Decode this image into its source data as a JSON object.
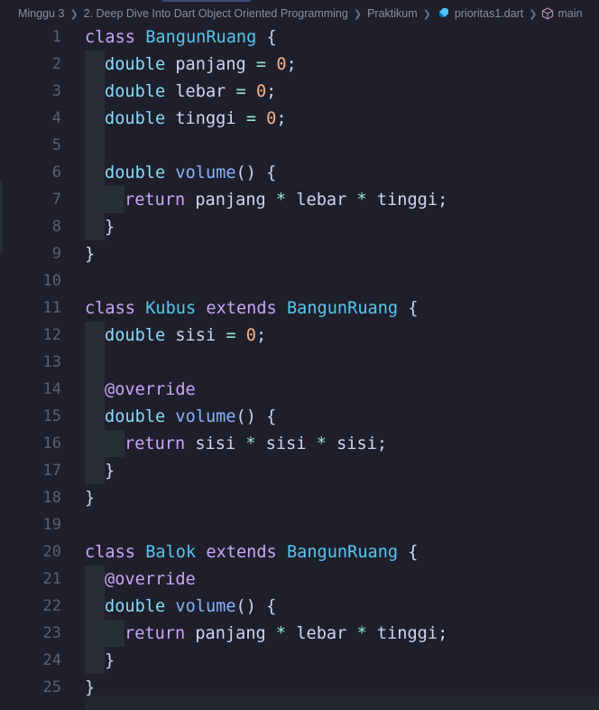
{
  "breadcrumb": {
    "items": [
      "Minggu 3",
      "2. Deep Dive Into Dart Object Oriented Programming",
      "Praktikum",
      "prioritas1.dart",
      "main"
    ]
  },
  "colors": {
    "background": "#1e1f2b",
    "keyword": "#cba6f7",
    "type": "#89dcfa",
    "class_name": "#56c8f0",
    "number": "#fab387",
    "function": "#89b4fa",
    "text": "#cdd6f4",
    "line_number": "#5c6078"
  },
  "icons": {
    "separator": "chevron-right-icon",
    "file": "dart-file-icon",
    "symbol": "cube-icon"
  },
  "editor": {
    "lines": [
      {
        "n": "1",
        "indent": 0,
        "tokens": [
          [
            "kw",
            "class"
          ],
          [
            "t",
            " "
          ],
          [
            "cls",
            "BangunRuang"
          ],
          [
            "t",
            " {"
          ]
        ]
      },
      {
        "n": "2",
        "indent": 1,
        "tokens": [
          [
            "ty",
            "double"
          ],
          [
            "t",
            " panjang "
          ],
          [
            "op",
            "="
          ],
          [
            "t",
            " "
          ],
          [
            "num",
            "0"
          ],
          [
            "t",
            ";"
          ]
        ]
      },
      {
        "n": "3",
        "indent": 1,
        "tokens": [
          [
            "ty",
            "double"
          ],
          [
            "t",
            " lebar "
          ],
          [
            "op",
            "="
          ],
          [
            "t",
            " "
          ],
          [
            "num",
            "0"
          ],
          [
            "t",
            ";"
          ]
        ]
      },
      {
        "n": "4",
        "indent": 1,
        "tokens": [
          [
            "ty",
            "double"
          ],
          [
            "t",
            " tinggi "
          ],
          [
            "op",
            "="
          ],
          [
            "t",
            " "
          ],
          [
            "num",
            "0"
          ],
          [
            "t",
            ";"
          ]
        ]
      },
      {
        "n": "5",
        "indent": 1,
        "tokens": []
      },
      {
        "n": "6",
        "indent": 1,
        "tokens": [
          [
            "ty",
            "double"
          ],
          [
            "t",
            " "
          ],
          [
            "fn",
            "volume"
          ],
          [
            "t",
            "() {"
          ]
        ]
      },
      {
        "n": "7",
        "indent": 2,
        "tokens": [
          [
            "kw",
            "return"
          ],
          [
            "t",
            " panjang "
          ],
          [
            "op",
            "*"
          ],
          [
            "t",
            " lebar "
          ],
          [
            "op",
            "*"
          ],
          [
            "t",
            " tinggi;"
          ]
        ]
      },
      {
        "n": "8",
        "indent": 1,
        "tokens": [
          [
            "t",
            "}"
          ]
        ]
      },
      {
        "n": "9",
        "indent": 0,
        "tokens": [
          [
            "t",
            "}"
          ]
        ]
      },
      {
        "n": "10",
        "indent": 0,
        "tokens": []
      },
      {
        "n": "11",
        "indent": 0,
        "tokens": [
          [
            "kw",
            "class"
          ],
          [
            "t",
            " "
          ],
          [
            "cls",
            "Kubus"
          ],
          [
            "t",
            " "
          ],
          [
            "kw",
            "extends"
          ],
          [
            "t",
            " "
          ],
          [
            "cls",
            "BangunRuang"
          ],
          [
            "t",
            " {"
          ]
        ]
      },
      {
        "n": "12",
        "indent": 1,
        "tokens": [
          [
            "ty",
            "double"
          ],
          [
            "t",
            " sisi "
          ],
          [
            "op",
            "="
          ],
          [
            "t",
            " "
          ],
          [
            "num",
            "0"
          ],
          [
            "t",
            ";"
          ]
        ]
      },
      {
        "n": "13",
        "indent": 1,
        "tokens": []
      },
      {
        "n": "14",
        "indent": 1,
        "tokens": [
          [
            "ann",
            "@override"
          ]
        ]
      },
      {
        "n": "15",
        "indent": 1,
        "tokens": [
          [
            "ty",
            "double"
          ],
          [
            "t",
            " "
          ],
          [
            "fn",
            "volume"
          ],
          [
            "t",
            "() {"
          ]
        ]
      },
      {
        "n": "16",
        "indent": 2,
        "tokens": [
          [
            "kw",
            "return"
          ],
          [
            "t",
            " sisi "
          ],
          [
            "op",
            "*"
          ],
          [
            "t",
            " sisi "
          ],
          [
            "op",
            "*"
          ],
          [
            "t",
            " sisi;"
          ]
        ]
      },
      {
        "n": "17",
        "indent": 1,
        "tokens": [
          [
            "t",
            "}"
          ]
        ]
      },
      {
        "n": "18",
        "indent": 0,
        "tokens": [
          [
            "t",
            "}"
          ]
        ]
      },
      {
        "n": "19",
        "indent": 0,
        "tokens": []
      },
      {
        "n": "20",
        "indent": 0,
        "tokens": [
          [
            "kw",
            "class"
          ],
          [
            "t",
            " "
          ],
          [
            "cls",
            "Balok"
          ],
          [
            "t",
            " "
          ],
          [
            "kw",
            "extends"
          ],
          [
            "t",
            " "
          ],
          [
            "cls",
            "BangunRuang"
          ],
          [
            "t",
            " {"
          ]
        ]
      },
      {
        "n": "21",
        "indent": 1,
        "tokens": [
          [
            "ann",
            "@override"
          ]
        ]
      },
      {
        "n": "22",
        "indent": 1,
        "tokens": [
          [
            "ty",
            "double"
          ],
          [
            "t",
            " "
          ],
          [
            "fn",
            "volume"
          ],
          [
            "t",
            "() {"
          ]
        ]
      },
      {
        "n": "23",
        "indent": 2,
        "tokens": [
          [
            "kw",
            "return"
          ],
          [
            "t",
            " panjang "
          ],
          [
            "op",
            "*"
          ],
          [
            "t",
            " lebar "
          ],
          [
            "op",
            "*"
          ],
          [
            "t",
            " tinggi;"
          ]
        ]
      },
      {
        "n": "24",
        "indent": 1,
        "tokens": [
          [
            "t",
            "}"
          ]
        ]
      },
      {
        "n": "25",
        "indent": 0,
        "tokens": [
          [
            "t",
            "}"
          ]
        ]
      }
    ]
  }
}
